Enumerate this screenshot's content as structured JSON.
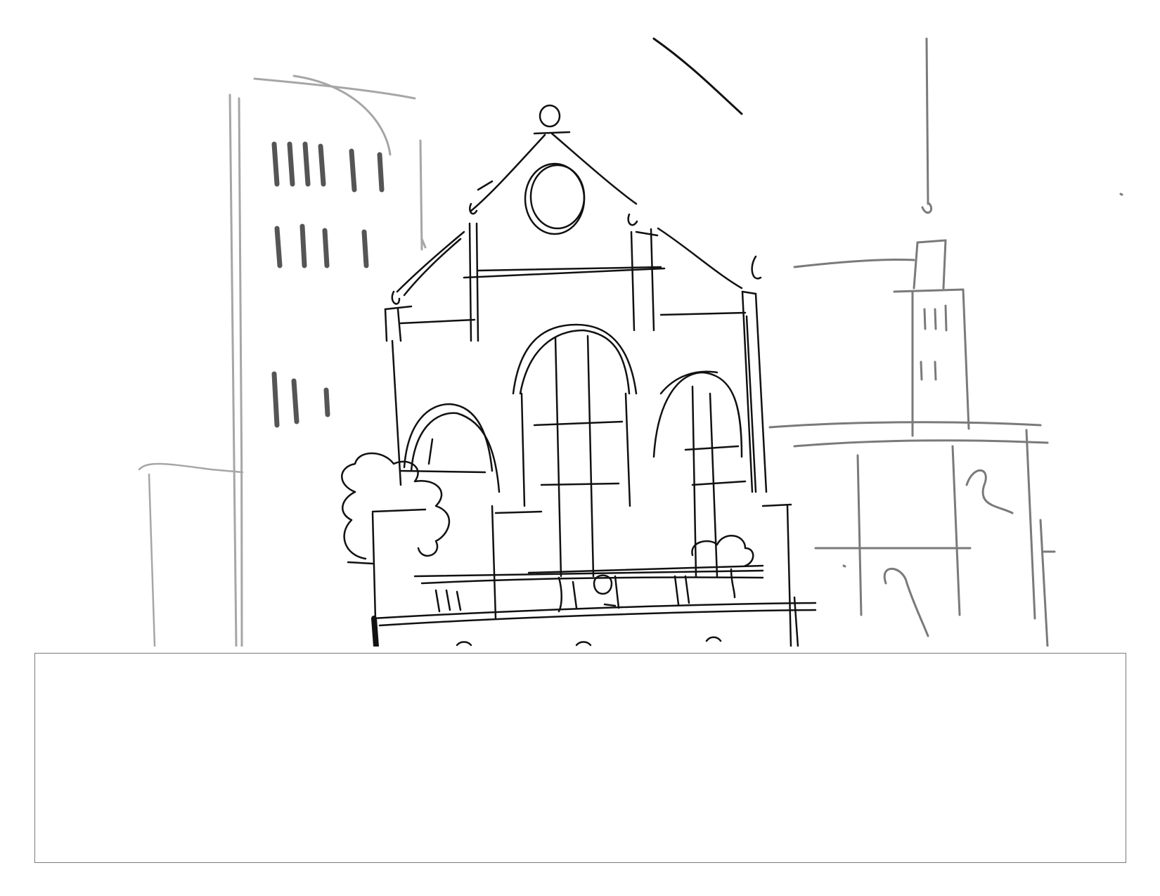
{
  "panel": {
    "caption_text": ""
  },
  "colors": {
    "ink_dark": "#111111",
    "ink_mid": "#7a7a7a",
    "ink_light": "#a6a6a6",
    "caption_border": "#7a7a7a",
    "background": "#ffffff"
  }
}
